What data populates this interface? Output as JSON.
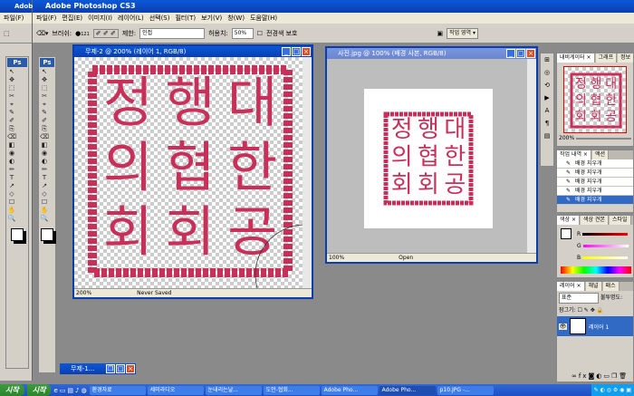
{
  "app": {
    "left_window_title": "Adob",
    "main_window_title": "Adobe Photoshop CS3",
    "left_menu": [
      "파일(F)",
      "편집"
    ],
    "menu": [
      "파일(F)",
      "편집(E)",
      "이미지(I)",
      "레이어(L)",
      "선택(S)",
      "필터(T)",
      "보기(V)",
      "창(W)",
      "도움말(H)"
    ]
  },
  "options": {
    "brush_label": "브러쉬:",
    "brush_size": "121",
    "limit_label": "제한:",
    "limit_value": "인접",
    "tolerance_label": "허용치:",
    "tolerance_value": "50%",
    "protect_label": "전경색 보호",
    "workspace_label": "작업 영역 ▾"
  },
  "doc1": {
    "title": "무제-2 @ 200% (레이어 1, RGB/8)",
    "zoom": "200%",
    "status": "Never Saved"
  },
  "doc2": {
    "title": "사진.jpg @ 100% (배경 사본, RGB/8)",
    "zoom": "100%",
    "status": "Open"
  },
  "seal": {
    "chars": [
      "대",
      "한",
      "공",
      "행",
      "협",
      "회",
      "정",
      "의",
      "회"
    ]
  },
  "navigator": {
    "tabs": [
      "내비게이터 ×",
      "그래프",
      "정보"
    ],
    "zoom": "200%"
  },
  "history": {
    "tabs": [
      "작업 내역 ×",
      "액션"
    ],
    "items": [
      "배경 지우개",
      "배경 지우개",
      "배경 지우개",
      "배경 지우개",
      "배경 지우개"
    ],
    "selected_index": 4
  },
  "color_panel": {
    "tabs": [
      "색상 ×",
      "색상 견본",
      "스타일"
    ],
    "labels": [
      "R",
      "G",
      "B"
    ]
  },
  "layers": {
    "tabs": [
      "레이어 ×",
      "채널",
      "패스"
    ],
    "blend_mode": "표준",
    "opacity_label": "불투명도:",
    "lock_label": "잠그기:",
    "layer_name": "레이어 1"
  },
  "minimized": {
    "title": "무제-1..."
  },
  "taskbar": {
    "start_labels": [
      "시작",
      "시작"
    ],
    "buttons": [
      "환경자료",
      "세미라디오",
      "눈내리는날...",
      "도안-협회...",
      "Adobe Pho...",
      "Adobe Pho...",
      "p10.JPG -..."
    ],
    "active_index": 5
  },
  "colors": {
    "seal_red": "#c8305a",
    "titlebar_blue": "#0a3eb0",
    "selection_blue": "#316ac5"
  }
}
